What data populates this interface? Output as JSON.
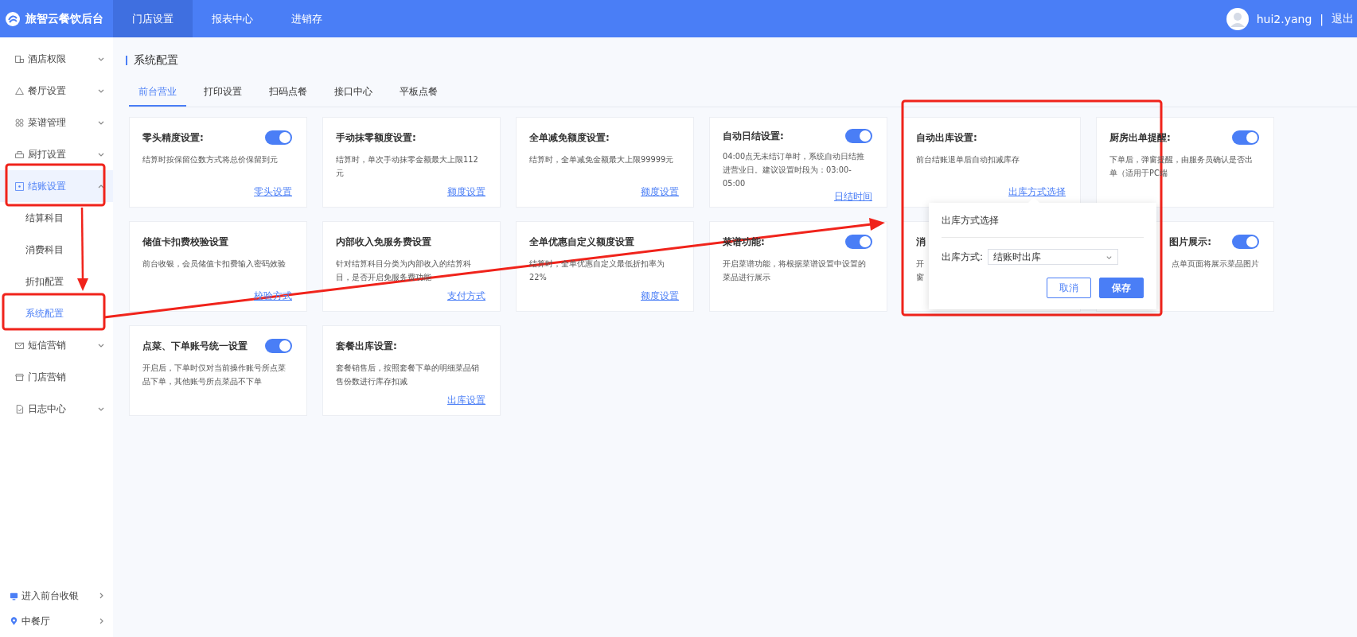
{
  "app": {
    "title": "旅智云餐饮后台"
  },
  "top_nav": [
    {
      "label": "门店设置",
      "selected": true
    },
    {
      "label": "报表中心",
      "selected": false
    },
    {
      "label": "进销存",
      "selected": false
    }
  ],
  "user": {
    "name": "hui2.yang",
    "separator": "|",
    "logout": "退出"
  },
  "sidebar": {
    "items": [
      {
        "label": "酒店权限",
        "expanded": false
      },
      {
        "label": "餐厅设置",
        "expanded": false
      },
      {
        "label": "菜谱管理",
        "expanded": false
      },
      {
        "label": "厨打设置",
        "expanded": false
      },
      {
        "label": "结账设置",
        "expanded": true,
        "children": [
          {
            "label": "结算科目",
            "selected": false
          },
          {
            "label": "消费科目",
            "selected": false
          },
          {
            "label": "折扣配置",
            "selected": false
          },
          {
            "label": "系统配置",
            "selected": true
          }
        ]
      },
      {
        "label": "短信营销",
        "expanded": false
      },
      {
        "label": "门店营销"
      },
      {
        "label": "日志中心",
        "expanded": false
      }
    ],
    "footer": [
      {
        "label": "进入前台收银"
      },
      {
        "label": "中餐厅"
      }
    ]
  },
  "page": {
    "title": "系统配置"
  },
  "tabs": [
    {
      "label": "前台营业",
      "selected": true
    },
    {
      "label": "打印设置",
      "selected": false
    },
    {
      "label": "扫码点餐",
      "selected": false
    },
    {
      "label": "接口中心",
      "selected": false
    },
    {
      "label": "平板点餐",
      "selected": false
    }
  ],
  "cards": [
    {
      "kind": "switch",
      "title": "零头精度设置:",
      "on": true,
      "desc": "结算时按保留位数方式将总价保留到元",
      "link": "零头设置"
    },
    {
      "kind": "plain",
      "title": "手动抹零额度设置:",
      "desc": "结算时，单次手动抹零金额最大上限112元",
      "link": "额度设置"
    },
    {
      "kind": "plain",
      "title": "全单减免额度设置:",
      "desc": "结算时，全单减免金额最大上限99999元",
      "link": "额度设置"
    },
    {
      "kind": "switch",
      "title": "自动日结设置:",
      "on": true,
      "desc": "04:00点无未结订单时，系统自动日结推进营业日。建议设置时段为：03:00-05:00",
      "link": "日结时间"
    },
    {
      "kind": "plain",
      "title": "自动出库设置:",
      "desc": "前台结账退单后自动扣减库存",
      "link": "出库方式选择"
    },
    {
      "kind": "switch",
      "title": "厨房出单提醒:",
      "on": true,
      "desc": "下单后，弹窗提醒，由服务员确认是否出单（适用于PC端"
    },
    {
      "kind": "plain",
      "title": "储值卡扣费校验设置",
      "desc": "前台收银，会员储值卡扣费输入密码效验",
      "link": "校验方式"
    },
    {
      "kind": "plain",
      "title": "内部收入免服务费设置",
      "desc": "针对结算科目分类为内部收入的结算科目，是否开启免服务费功能",
      "link": "支付方式"
    },
    {
      "kind": "plain",
      "title": "全单优惠自定义额度设置",
      "desc": "结算时，全单优惠自定义最低折扣率为22%",
      "link": "额度设置"
    },
    {
      "kind": "switch",
      "title": "菜谱功能:",
      "on": true,
      "desc": "开启菜谱功能，将根据菜谱设置中设置的菜品进行展示"
    },
    {
      "kind": "plain",
      "title": "消",
      "lines": [
        "开",
        "窗"
      ]
    },
    {
      "kind": "switch-end",
      "title": "图片展示:",
      "on": true,
      "desc": "点单页面将展示菜品图片"
    },
    {
      "kind": "switch",
      "title": "点菜、下单账号统一设置",
      "on": true,
      "desc": "开启后，下单时仅对当前操作账号所点菜品下单，其他账号所点菜品不下单"
    },
    {
      "kind": "plain",
      "title": "套餐出库设置:",
      "desc": "套餐销售后，按照套餐下单的明细菜品销售份数进行库存扣减",
      "link": "出库设置"
    }
  ],
  "popover": {
    "title": "出库方式选择",
    "label": "出库方式:",
    "value": "结账时出库",
    "buttons": [
      "取消",
      "保存"
    ]
  }
}
